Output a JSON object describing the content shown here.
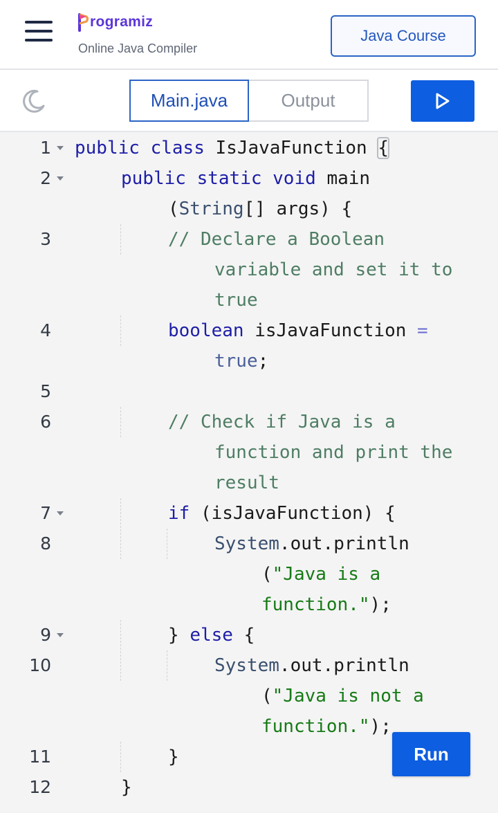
{
  "header": {
    "logo_text": "rogramiz",
    "subtitle": "Online Java Compiler",
    "course_button": "Java Course",
    "brand_color": "#5b35d8"
  },
  "toolbar": {
    "theme_icon": "moon-icon",
    "tabs": [
      {
        "label": "Main.java",
        "active": true
      },
      {
        "label": "Output",
        "active": false
      }
    ],
    "run_icon": "play-icon",
    "accent_color": "#0d5ee0"
  },
  "editor": {
    "run_label": "Run",
    "line_numbers": [
      "1",
      "2",
      "3",
      "4",
      "5",
      "6",
      "7",
      "8",
      "9",
      "10",
      "11",
      "12"
    ],
    "foldable_lines": [
      1,
      2,
      7,
      9
    ],
    "code": {
      "l1_a": "public",
      "l1_b": "class",
      "l1_c": "IsJavaFunction",
      "l1_d": "{",
      "l2_a": "public",
      "l2_b": "static",
      "l2_c": "void",
      "l2_d": "main",
      "l2w_a": "(",
      "l2w_b": "String",
      "l2w_c": "[] args) {",
      "l3_a": "// Declare a Boolean",
      "l3_b": "variable and set it to",
      "l3_c": "true",
      "l4_a": "boolean",
      "l4_b": "isJavaFunction",
      "l4_c": "=",
      "l4_d": "true",
      "l4_e": ";",
      "l6_a": "// Check if Java is a",
      "l6_b": "function and print the",
      "l6_c": "result",
      "l7_a": "if",
      "l7_b": "(isJavaFunction) {",
      "l8_a": "System",
      "l8_b": ".out.println",
      "l8_c": "(",
      "l8_d": "\"Java is a",
      "l8_e": "function.\"",
      "l8_f": ");",
      "l9_a": "}",
      "l9_b": "else",
      "l9_c": "{",
      "l10_a": "System",
      "l10_b": ".out.println",
      "l10_c": "(",
      "l10_d": "\"Java is not a",
      "l10_e": "function.\"",
      "l10_f": ");",
      "l11_a": "}",
      "l12_a": "}"
    }
  }
}
